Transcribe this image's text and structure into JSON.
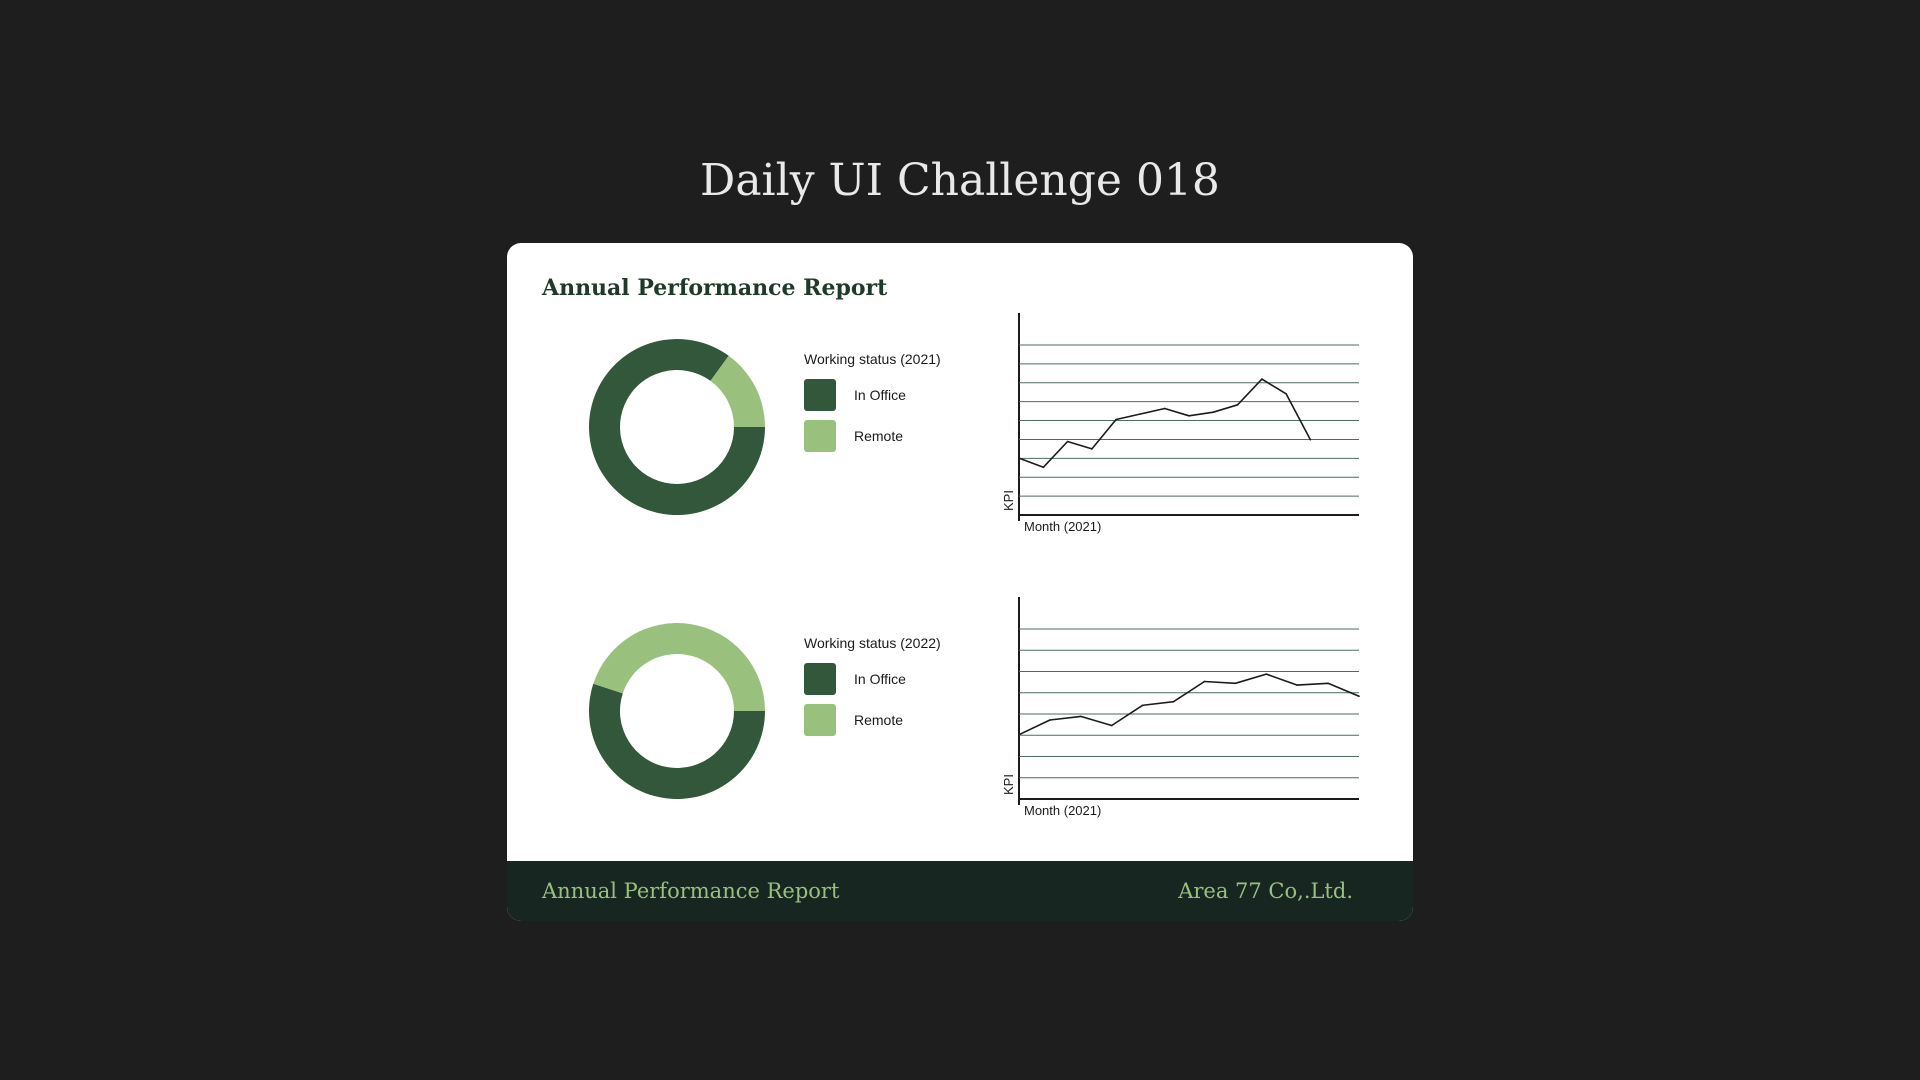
{
  "page": {
    "title": "Daily UI Challenge 018"
  },
  "card": {
    "title": "Annual Performance Report"
  },
  "footer": {
    "left": "Annual Performance Report",
    "right": "Area 77 Co,.Ltd."
  },
  "colors": {
    "in_office": "#32573a",
    "remote": "#9ac07e",
    "grid": "#4f6b5c",
    "axis": "#1b1b1b",
    "line": "#1b1b1b"
  },
  "chart_data": [
    {
      "type": "pie",
      "title": "Working status (2021)",
      "series": [
        {
          "name": "In Office",
          "value": 85
        },
        {
          "name": "Remote",
          "value": 15
        }
      ]
    },
    {
      "type": "line",
      "xlabel": "Month (2021)",
      "ylabel": "KPI",
      "grid": true,
      "ylim": [
        0,
        11
      ],
      "gridlines": 9,
      "x": [
        1,
        2,
        3,
        4,
        5,
        6,
        7,
        8,
        9,
        10,
        11,
        12,
        13,
        14,
        15
      ],
      "values": [
        3.1,
        2.6,
        4.0,
        3.6,
        5.2,
        5.5,
        5.8,
        5.4,
        5.6,
        6.0,
        7.4,
        6.6,
        4.1,
        null,
        null
      ]
    },
    {
      "type": "pie",
      "title": "Working status (2022)",
      "series": [
        {
          "name": "In Office",
          "value": 55
        },
        {
          "name": "Remote",
          "value": 45
        }
      ]
    },
    {
      "type": "line",
      "xlabel": "Month (2021)",
      "ylabel": "KPI",
      "grid": true,
      "ylim": [
        0,
        11
      ],
      "gridlines": 8,
      "x": [
        1,
        2,
        3,
        4,
        5,
        6,
        7,
        8,
        9,
        10,
        11,
        12
      ],
      "values": [
        3.5,
        4.3,
        4.5,
        4.0,
        5.1,
        5.3,
        6.4,
        6.3,
        6.8,
        6.2,
        6.3,
        5.6
      ]
    }
  ]
}
